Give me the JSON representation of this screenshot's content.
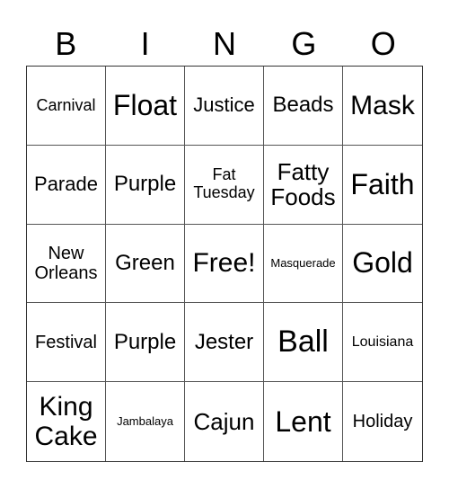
{
  "header": [
    "B",
    "I",
    "N",
    "G",
    "O"
  ],
  "cells": [
    "Carnival",
    "Float",
    "Justice",
    "Beads",
    "Mask",
    "Parade",
    "Purple",
    "Fat Tuesday",
    "Fatty Foods",
    "Faith",
    "New Orleans",
    "Green",
    "Free!",
    "Masquerade",
    "Gold",
    "Festival",
    "Purple",
    "Jester",
    "Ball",
    "Louisiana",
    "King Cake",
    "Jambalaya",
    "Cajun",
    "Lent",
    "Holiday"
  ]
}
